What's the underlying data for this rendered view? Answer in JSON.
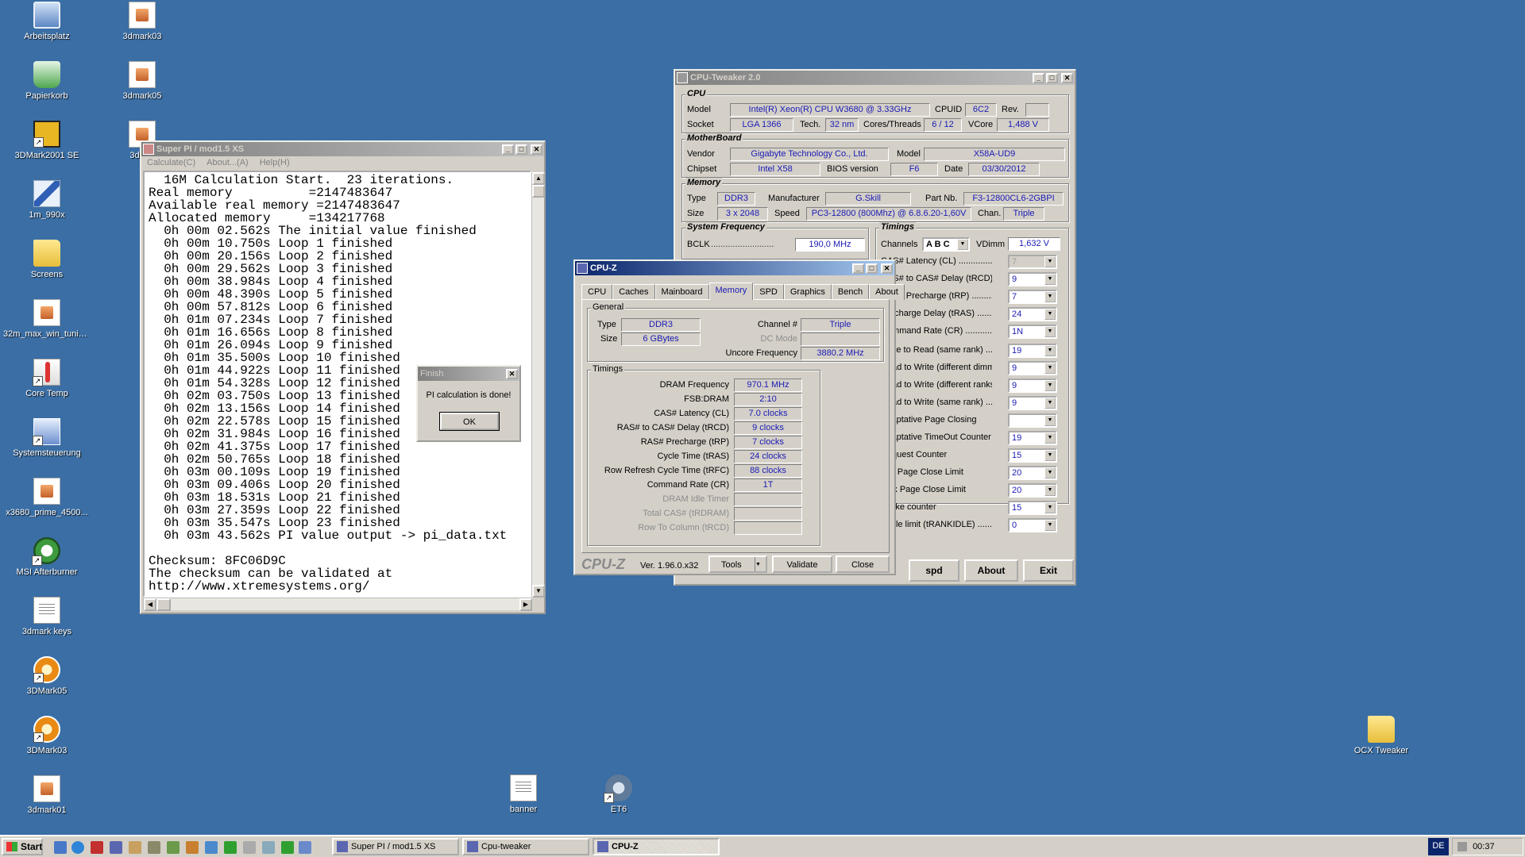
{
  "desktop_icons_left": [
    {
      "label": "Arbeitsplatz",
      "icon": "computer-icon"
    },
    {
      "label": "Papierkorb",
      "icon": "recycle-bin-icon"
    },
    {
      "label": "3DMark2001 SE",
      "icon": "3dmark2001-icon"
    },
    {
      "label": "1m_990x",
      "icon": "pencil-file-icon"
    },
    {
      "label": "Screens",
      "icon": "folder-icon"
    },
    {
      "label": "32m_max_win_tunin...",
      "icon": "file-icon"
    },
    {
      "label": "Core Temp",
      "icon": "thermometer-icon"
    },
    {
      "label": "Systemsteuerung",
      "icon": "control-panel-icon"
    },
    {
      "label": "x3680_prime_4500...",
      "icon": "file-icon"
    },
    {
      "label": "MSI Afterburner",
      "icon": "msi-afterburner-icon"
    },
    {
      "label": "3dmark keys",
      "icon": "text-file-icon"
    },
    {
      "label": "3DMark05",
      "icon": "3dmark-icon"
    },
    {
      "label": "3DMark03",
      "icon": "3dmark-icon"
    },
    {
      "label": "3dmark01",
      "icon": "file-icon"
    }
  ],
  "desktop_icons_col2": [
    {
      "label": "3dmark03"
    },
    {
      "label": "3dmark05"
    },
    {
      "label": "3dmar"
    }
  ],
  "desktop_icons_bottom": [
    {
      "label": "banner",
      "icon": "text-file-icon"
    },
    {
      "label": "ET6",
      "icon": "et6-icon"
    }
  ],
  "desktop_icon_right": {
    "label": "OCX Tweaker",
    "icon": "folder-icon"
  },
  "superpi": {
    "title": "Super PI / mod1.5 XS",
    "menu": [
      "Calculate(C)",
      "About...(A)",
      "Help(H)"
    ],
    "output_lines": [
      "  16M Calculation Start.  23 iterations.",
      "Real memory          =2147483647",
      "Available real memory =2147483647",
      "Allocated memory     =134217768",
      "  0h 00m 02.562s The initial value finished",
      "  0h 00m 10.750s Loop 1 finished",
      "  0h 00m 20.156s Loop 2 finished",
      "  0h 00m 29.562s Loop 3 finished",
      "  0h 00m 38.984s Loop 4 finished",
      "  0h 00m 48.390s Loop 5 finished",
      "  0h 00m 57.812s Loop 6 finished",
      "  0h 01m 07.234s Loop 7 finished",
      "  0h 01m 16.656s Loop 8 finished",
      "  0h 01m 26.094s Loop 9 finished",
      "  0h 01m 35.500s Loop 10 finished",
      "  0h 01m 44.922s Loop 11 finished",
      "  0h 01m 54.328s Loop 12 finished",
      "  0h 02m 03.750s Loop 13 finished",
      "  0h 02m 13.156s Loop 14 finished",
      "  0h 02m 22.578s Loop 15 finished",
      "  0h 02m 31.984s Loop 16 finished",
      "  0h 02m 41.375s Loop 17 finished",
      "  0h 02m 50.765s Loop 18 finished",
      "  0h 03m 00.109s Loop 19 finished",
      "  0h 03m 09.406s Loop 20 finished",
      "  0h 03m 18.531s Loop 21 finished",
      "  0h 03m 27.359s Loop 22 finished",
      "  0h 03m 35.547s Loop 23 finished",
      "  0h 03m 43.562s PI value output -> pi_data.txt",
      "",
      "Checksum: 8FC06D9C",
      "The checksum can be validated at",
      "http://www.xtremesystems.org/"
    ]
  },
  "finish_dialog": {
    "title": "Finish",
    "message": "PI calculation is done!",
    "ok": "OK"
  },
  "cputweaker": {
    "title": "CPU-Tweaker 2.0",
    "cpu": {
      "heading": "CPU",
      "model_label": "Model",
      "model": "Intel(R) Xeon(R) CPU       W3680  @ 3.33GHz",
      "cpuid_label": "CPUID",
      "cpuid": "6C2",
      "rev_label": "Rev.",
      "rev": "",
      "socket_label": "Socket",
      "socket": "LGA 1366",
      "tech_label": "Tech.",
      "tech": "32 nm",
      "cores_label": "Cores/Threads",
      "cores": "6 / 12",
      "vcore_label": "VCore",
      "vcore": "1,488 V"
    },
    "motherboard": {
      "heading": "MotherBoard",
      "vendor_label": "Vendor",
      "vendor": "Gigabyte Technology Co., Ltd.",
      "model_label": "Model",
      "model": "X58A-UD9",
      "chipset_label": "Chipset",
      "chipset": "Intel X58",
      "bios_label": "BIOS version",
      "bios": "F6",
      "date_label": "Date",
      "date": "03/30/2012"
    },
    "memory": {
      "heading": "Memory",
      "type_label": "Type",
      "type": "DDR3",
      "manuf_label": "Manufacturer",
      "manuf": "G.Skill",
      "part_label": "Part Nb.",
      "part": "F3-12800CL6-2GBPI",
      "size_label": "Size",
      "size": "3 x 2048",
      "speed_label": "Speed",
      "speed": "PC3-12800 (800Mhz) @ 6.8.6.20-1,60V",
      "chan_label": "Chan.",
      "chan": "Triple"
    },
    "sysfreq": {
      "heading": "System Frequency",
      "bclk_label": "BCLK",
      "bclk": "190,0 MHz"
    },
    "timings": {
      "heading": "Timings",
      "channels_label": "Channels",
      "channels": "A B C",
      "vdimm_label": "VDimm",
      "vdimm": "1,632 V",
      "rows": [
        {
          "label": "CAS# Latency (CL) ..................",
          "value": "7",
          "disabled": true
        },
        {
          "label": "RAS# to CAS# Delay (tRCD) .....",
          "value": "9"
        },
        {
          "label": "RAS# Precharge (tRP) ...............",
          "value": "7"
        },
        {
          "label": "Precharge Delay (tRAS) .............",
          "value": "24"
        },
        {
          "label": "Command Rate (CR) ..................",
          "value": "1N"
        }
      ],
      "rows2": [
        {
          "label": "Write to Read (same rank) ..........",
          "value": "19"
        },
        {
          "label": "Read to Write (different dimms) ....",
          "value": "9"
        },
        {
          "label": "Read to Write (different ranks) ....",
          "value": "9"
        },
        {
          "label": "Read to Write (same rank) ..........",
          "value": "9"
        },
        {
          "label": "Adaptative Page Closing",
          "value": ""
        },
        {
          "label": "Adaptative TimeOut Counter",
          "value": "19"
        },
        {
          "label": "Request Counter",
          "value": "15"
        },
        {
          "label": "Min Page Close Limit",
          "value": "20"
        },
        {
          "label": "Max Page Close Limit",
          "value": "20"
        },
        {
          "label": "Intake counter",
          "value": "15"
        },
        {
          "label": "Cycle limit (tRANKIDLE) .........",
          "value": "0"
        }
      ]
    },
    "buttons": {
      "spd": "spd",
      "about": "About",
      "exit": "Exit"
    }
  },
  "cpuz": {
    "title": "CPU-Z",
    "tabs": [
      "CPU",
      "Caches",
      "Mainboard",
      "Memory",
      "SPD",
      "Graphics",
      "Bench",
      "About"
    ],
    "selected_tab": 3,
    "general": {
      "heading": "General",
      "type_label": "Type",
      "type": "DDR3",
      "size_label": "Size",
      "size": "6 GBytes",
      "channel_label": "Channel #",
      "channel": "Triple",
      "dcmode_label": "DC Mode",
      "dcmode": "",
      "uncore_label": "Uncore Frequency",
      "uncore": "3880.2 MHz"
    },
    "timings": {
      "heading": "Timings",
      "rows": [
        {
          "label": "DRAM Frequency",
          "value": "970.1 MHz"
        },
        {
          "label": "FSB:DRAM",
          "value": "2:10"
        },
        {
          "label": "CAS# Latency (CL)",
          "value": "7.0 clocks"
        },
        {
          "label": "RAS# to CAS# Delay (tRCD)",
          "value": "9 clocks"
        },
        {
          "label": "RAS# Precharge (tRP)",
          "value": "7 clocks"
        },
        {
          "label": "Cycle Time (tRAS)",
          "value": "24 clocks"
        },
        {
          "label": "Row Refresh Cycle Time (tRFC)",
          "value": "88 clocks"
        },
        {
          "label": "Command Rate (CR)",
          "value": "1T"
        },
        {
          "label": "DRAM Idle Timer",
          "value": "",
          "disabled": true
        },
        {
          "label": "Total CAS# (tRDRAM)",
          "value": "",
          "disabled": true
        },
        {
          "label": "Row To Column (tRCD)",
          "value": "",
          "disabled": true
        }
      ]
    },
    "footer": {
      "brand": "CPU-Z",
      "version": "Ver. 1.96.0.x32",
      "tools": "Tools",
      "validate": "Validate",
      "close": "Close"
    }
  },
  "taskbar": {
    "start": "Start",
    "tasks": [
      {
        "label": "Super PI / mod1.5 XS",
        "pressed": false
      },
      {
        "label": "Cpu-tweaker",
        "pressed": false
      },
      {
        "label": "CPU-Z",
        "pressed": true
      }
    ],
    "lang": "DE",
    "clock": "00:37"
  }
}
